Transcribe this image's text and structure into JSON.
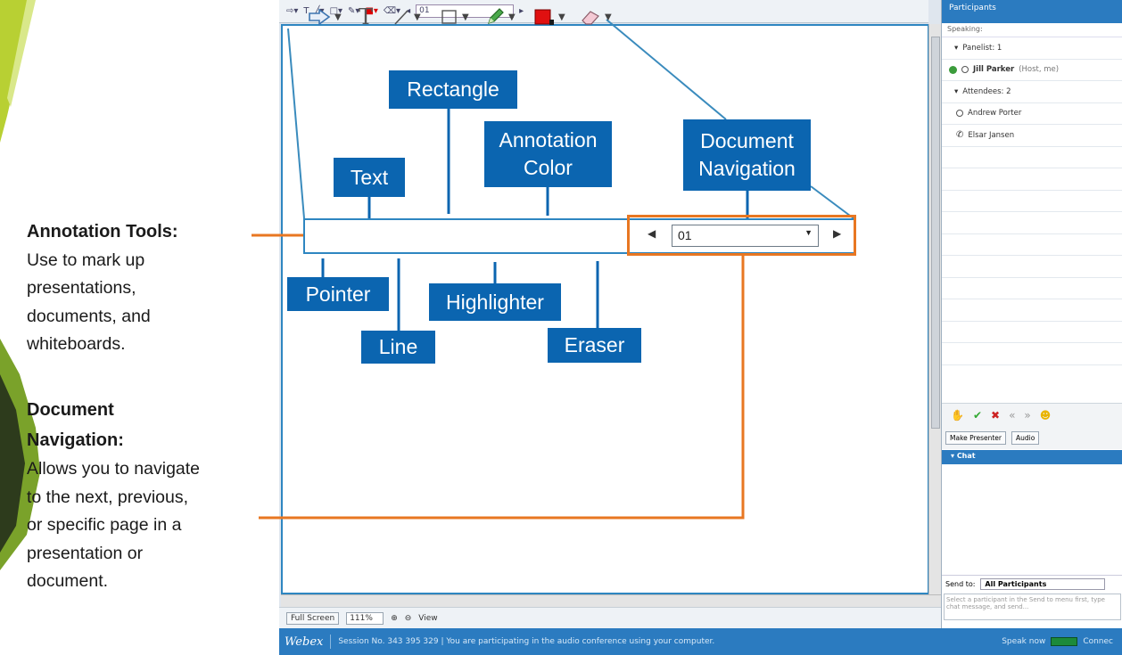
{
  "help": {
    "annotation_title": "Annotation Tools:",
    "annotation_body": "Use to mark up\npresentations,\ndocuments, and\nwhiteboards.",
    "navigation_title": "Document\nNavigation:",
    "navigation_body": "Allows you to navigate\nto the next, previous,\nor specific page in a\npresentation or\ndocument."
  },
  "callouts": {
    "rectangle": "Rectangle",
    "annotation_color": "Annotation\nColor",
    "text": "Text",
    "document_navigation": "Document\nNavigation",
    "pointer": "Pointer",
    "highlighter": "Highlighter",
    "line": "Line",
    "eraser": "Eraser"
  },
  "toolbar": {
    "page_value": "01",
    "annotation_color": "#e01010",
    "highlighter_color": "#4aa84a",
    "icons": [
      "pointer-arrow-icon",
      "text-tool-icon",
      "line-tool-icon",
      "rectangle-tool-icon",
      "highlighter-pen-icon",
      "color-swatch-icon",
      "eraser-icon",
      "previous-page-icon",
      "next-page-icon"
    ]
  },
  "app": {
    "top_page_value": "01",
    "zoom": "111%",
    "full_screen": "Full Screen",
    "view": "View",
    "status_text": "Session No. 343 395 329  |  You are participating in the audio conference using your computer.",
    "logo": "Webex",
    "speak_now": "Speak now",
    "connect": "Connec"
  },
  "panel": {
    "title": "Participants",
    "speaking": "Speaking:",
    "panelist_group": "Panelist: 1",
    "host_name": "Jill Parker",
    "host_role": "(Host, me)",
    "attendee_group": "Attendees: 2",
    "attendees": [
      "Andrew Porter",
      "Elsar Jansen"
    ],
    "make_presenter": "Make Presenter",
    "audio": "Audio",
    "chat": "Chat",
    "send_to_label": "Send to:",
    "send_to_value": "All Participants",
    "chat_placeholder": "Select a participant in the Send to menu first, type chat message, and send..."
  },
  "colors": {
    "callout_blue": "#0b65b0",
    "highlight_orange": "#e87722",
    "webex_blue": "#2b7bc0",
    "leader_line": "#3a8bbd"
  }
}
